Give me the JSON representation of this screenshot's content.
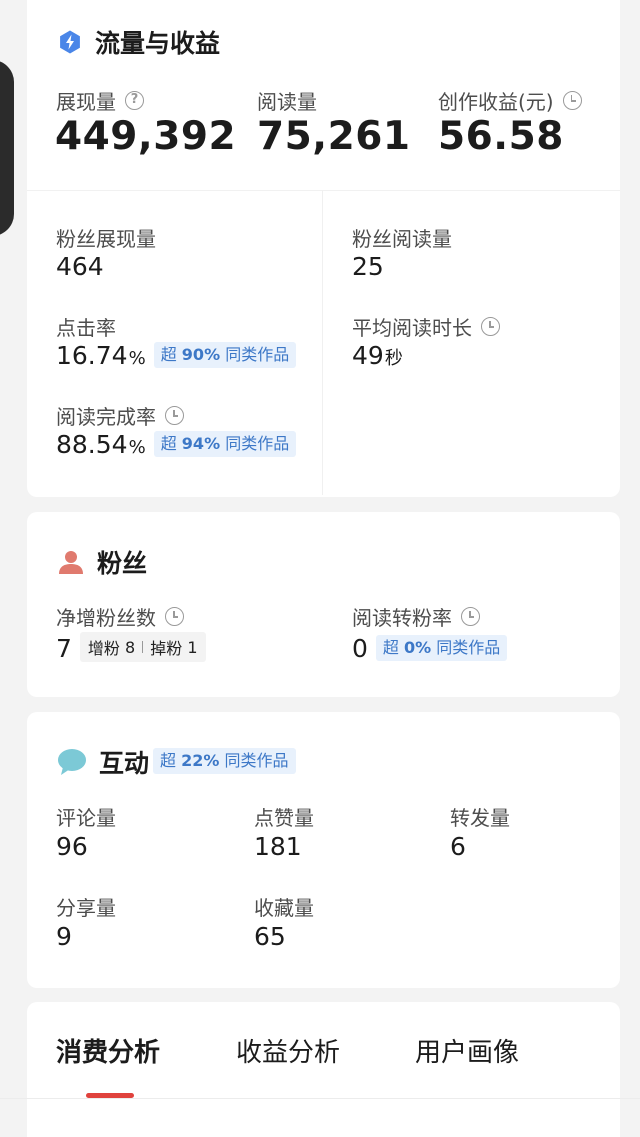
{
  "traffic": {
    "title": "流量与收益",
    "impressions_label": "展现量",
    "impressions_value": "449,392",
    "reads_label": "阅读量",
    "reads_value": "75,261",
    "earnings_label": "创作收益(元)",
    "earnings_value": "56.58",
    "fan_impressions_label": "粉丝展现量",
    "fan_impressions_value": "464",
    "fan_reads_label": "粉丝阅读量",
    "fan_reads_value": "25",
    "ctr_label": "点击率",
    "ctr_value": "16.74",
    "ctr_unit": "%",
    "ctr_chip_prefix": "超",
    "ctr_chip_pct": "90%",
    "ctr_chip_suffix": "同类作品",
    "avg_time_label": "平均阅读时长",
    "avg_time_value": "49",
    "avg_time_unit": "秒",
    "completion_label": "阅读完成率",
    "completion_value": "88.54",
    "completion_unit": "%",
    "completion_chip_prefix": "超",
    "completion_chip_pct": "94%",
    "completion_chip_suffix": "同类作品"
  },
  "fans": {
    "title": "粉丝",
    "net_label": "净增粉丝数",
    "net_value": "7",
    "gain_label": "增粉",
    "gain_value": "8",
    "loss_label": "掉粉",
    "loss_value": "1",
    "conv_label": "阅读转粉率",
    "conv_value": "0",
    "conv_chip_prefix": "超",
    "conv_chip_pct": "0%",
    "conv_chip_suffix": "同类作品"
  },
  "interaction": {
    "title": "互动",
    "chip_prefix": "超",
    "chip_pct": "22%",
    "chip_suffix": "同类作品",
    "comments_label": "评论量",
    "comments_value": "96",
    "likes_label": "点赞量",
    "likes_value": "181",
    "reposts_label": "转发量",
    "reposts_value": "6",
    "shares_label": "分享量",
    "shares_value": "9",
    "favorites_label": "收藏量",
    "favorites_value": "65"
  },
  "tabs": {
    "consumption": "消费分析",
    "revenue": "收益分析",
    "user_profile": "用户画像",
    "active": "消费分析"
  },
  "colors": {
    "accent_blue": "#3d78c7",
    "chip_bg": "#e8f1fc",
    "tab_underline": "#e0423d",
    "traffic_icon": "#4a86e8",
    "fans_icon": "#e07a6e",
    "interaction_icon": "#7cc9d6"
  },
  "icons": {
    "traffic": "lightning-bolt-icon",
    "fans": "person-icon",
    "interaction": "speech-bubble-icon",
    "help": "question-circle-icon",
    "history": "clock-icon"
  }
}
